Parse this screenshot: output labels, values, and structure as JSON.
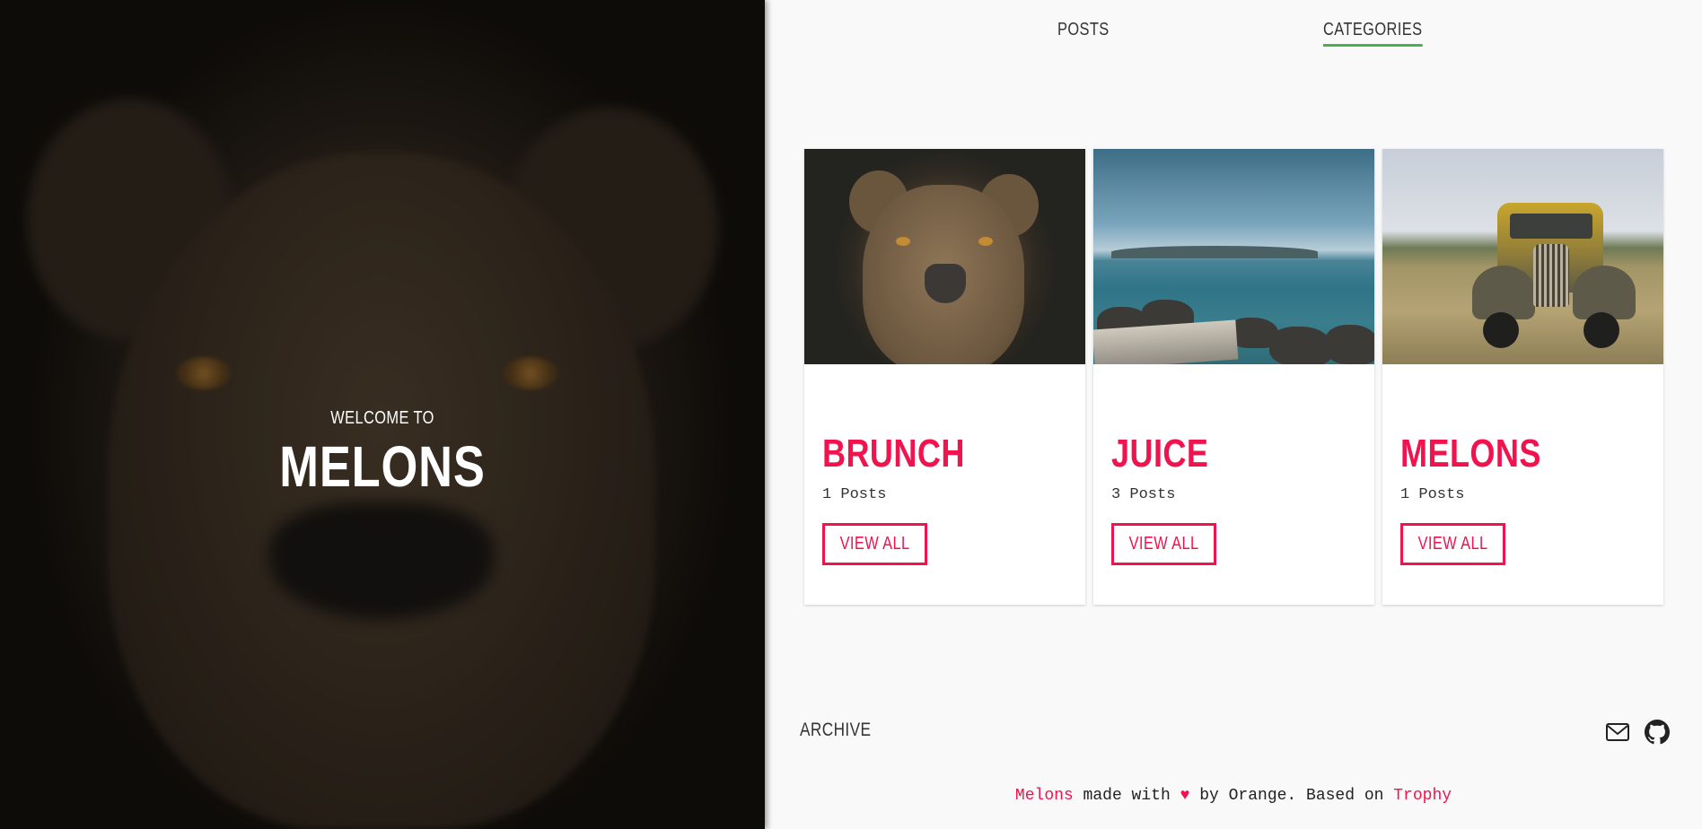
{
  "hero": {
    "welcome": "WELCOME TO",
    "title": "MELONS"
  },
  "nav": {
    "posts": "POSTS",
    "categories": "CATEGORIES",
    "active": "categories"
  },
  "categories": [
    {
      "title": "BRUNCH",
      "count": "1 Posts",
      "button": "VIEW ALL",
      "image": "lioness-photo"
    },
    {
      "title": "JUICE",
      "count": "3 Posts",
      "button": "VIEW ALL",
      "image": "sea-photo"
    },
    {
      "title": "MELONS",
      "count": "1 Posts",
      "button": "VIEW ALL",
      "image": "old-truck-photo"
    }
  ],
  "footer": {
    "archive": "ARCHIVE",
    "icons": [
      "mail-icon",
      "github-icon"
    ],
    "credits": {
      "site": "Melons",
      "made_with": "made with",
      "heart": "♥",
      "by": "by Orange. Based on",
      "theme": "Trophy"
    }
  },
  "colors": {
    "accent": "#f0134d",
    "nav_underline": "#4caf50",
    "background": "#f9f9f9"
  }
}
